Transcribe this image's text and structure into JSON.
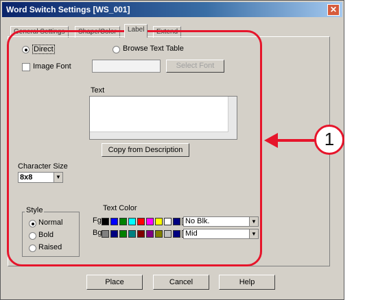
{
  "window": {
    "title": "Word Switch Settings [WS_001]"
  },
  "tabs": [
    {
      "label": "General Settings"
    },
    {
      "label": "Shape/Color"
    },
    {
      "label": "Label"
    },
    {
      "label": "Extend"
    }
  ],
  "label_tab": {
    "direct_label": "Direct",
    "browse_label": "Browse Text Table",
    "image_font_label": "Image Font",
    "select_font_label": "Select Font",
    "text_label": "Text",
    "copy_button": "Copy from Description",
    "char_size_label": "Character Size",
    "char_size_value": "8x8",
    "style_label": "Style",
    "style_options": [
      "Normal",
      "Bold",
      "Raised"
    ],
    "text_color_label": "Text Color",
    "fg_label": "Fg",
    "bg_label": "Bg",
    "fg_blink": "No Blk.",
    "bg_blink": "Mid"
  },
  "footer": {
    "place": "Place",
    "cancel": "Cancel",
    "help": "Help"
  },
  "callout": {
    "number": "1"
  },
  "colors": {
    "fg_swatches": [
      "#000000",
      "#0000ff",
      "#008000",
      "#00ffff",
      "#ff0000",
      "#ff00ff",
      "#ffff00",
      "#ffffff",
      "#000080"
    ],
    "bg_swatches": [
      "#808080",
      "#000080",
      "#008000",
      "#008080",
      "#800000",
      "#800080",
      "#808000",
      "#c0c0c0",
      "#000080"
    ],
    "accent_red": "#e6152b"
  }
}
